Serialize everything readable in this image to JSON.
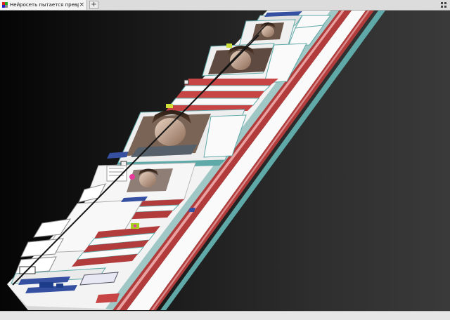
{
  "tab": {
    "title": "Нейросеть пытается превратить на...",
    "close_glyph": "×",
    "new_tab_glyph": "+"
  },
  "icons": {
    "favicon": "site-favicon",
    "tab_close": "close-icon",
    "new_tab": "plus-icon",
    "tab_list": "grid-icon"
  },
  "colors": {
    "tab_background": "#f4f4f4",
    "tab_strip": "#dcdcdc",
    "viewport_background": "#1a1a1a",
    "layer_red": "#b23b3b",
    "layer_teal": "#5fa9a8",
    "page_white": "#f5f5f5"
  }
}
